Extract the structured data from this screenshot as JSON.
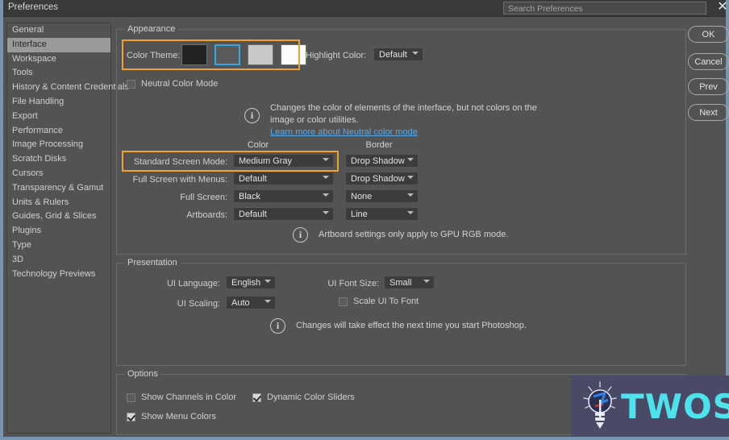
{
  "window": {
    "title": "Preferences",
    "close_icon": "close-icon"
  },
  "search": {
    "placeholder": "Search Preferences"
  },
  "sidebar": {
    "items": [
      {
        "label": "General",
        "selected": false
      },
      {
        "label": "Interface",
        "selected": true
      },
      {
        "label": "Workspace",
        "selected": false
      },
      {
        "label": "Tools",
        "selected": false
      },
      {
        "label": "History & Content Credentials",
        "selected": false
      },
      {
        "label": "File Handling",
        "selected": false
      },
      {
        "label": "Export",
        "selected": false
      },
      {
        "label": "Performance",
        "selected": false
      },
      {
        "label": "Image Processing",
        "selected": false
      },
      {
        "label": "Scratch Disks",
        "selected": false
      },
      {
        "label": "Cursors",
        "selected": false
      },
      {
        "label": "Transparency & Gamut",
        "selected": false
      },
      {
        "label": "Units & Rulers",
        "selected": false
      },
      {
        "label": "Guides, Grid & Slices",
        "selected": false
      },
      {
        "label": "Plugins",
        "selected": false
      },
      {
        "label": "Type",
        "selected": false
      },
      {
        "label": "3D",
        "selected": false
      },
      {
        "label": "Technology Previews",
        "selected": false
      }
    ]
  },
  "appearance": {
    "legend": "Appearance",
    "color_theme_label": "Color Theme:",
    "swatches": [
      {
        "name": "theme-darkest",
        "color": "#232323",
        "selected": false
      },
      {
        "name": "theme-dark",
        "color": "#5a5a5a",
        "selected": true
      },
      {
        "name": "theme-light",
        "color": "#c8c8c8",
        "selected": false
      },
      {
        "name": "theme-lightest",
        "color": "#fbfbfb",
        "selected": false
      }
    ],
    "highlight_color_label": "Highlight Color:",
    "highlight_color_value": "Default",
    "neutral_color_mode_label": "Neutral Color Mode",
    "neutral_color_mode_checked": false,
    "info_note_line1": "Changes the color of elements of the interface, but not colors on the",
    "info_note_line2": "image or color utilities.",
    "learn_more_link": "Learn more about Neutral color mode",
    "column_color": "Color",
    "column_border": "Border",
    "rows": [
      {
        "label": "Standard Screen Mode:",
        "color": "Medium Gray",
        "border": "Drop Shadow"
      },
      {
        "label": "Full Screen with Menus:",
        "color": "Default",
        "border": "Drop Shadow"
      },
      {
        "label": "Full Screen:",
        "color": "Black",
        "border": "None"
      },
      {
        "label": "Artboards:",
        "color": "Default",
        "border": "Line"
      }
    ],
    "artboard_note": "Artboard settings only apply to GPU RGB mode."
  },
  "presentation": {
    "legend": "Presentation",
    "ui_language_label": "UI Language:",
    "ui_language_value": "English",
    "ui_font_size_label": "UI Font Size:",
    "ui_font_size_value": "Small",
    "ui_scaling_label": "UI Scaling:",
    "ui_scaling_value": "Auto",
    "scale_ui_to_font_label": "Scale UI To Font",
    "scale_ui_to_font_checked": false,
    "restart_note": "Changes will take effect the next time you start Photoshop."
  },
  "options": {
    "legend": "Options",
    "show_channels_label": "Show Channels in Color",
    "show_channels_checked": false,
    "dynamic_sliders_label": "Dynamic Color Sliders",
    "dynamic_sliders_checked": true,
    "show_menu_colors_label": "Show Menu Colors",
    "show_menu_colors_checked": true
  },
  "buttons": {
    "ok": "OK",
    "cancel": "Cancel",
    "prev": "Prev",
    "next": "Next"
  },
  "watermark": {
    "text": "TWOS",
    "accent": "#4de3ec",
    "background": "#4b4a66"
  }
}
